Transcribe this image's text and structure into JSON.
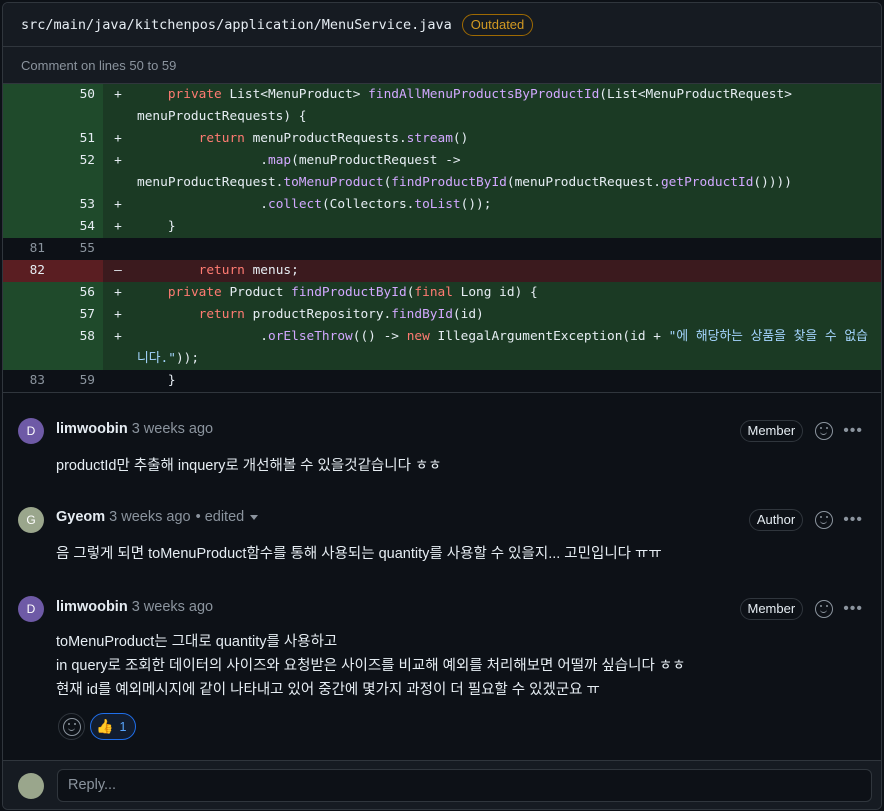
{
  "file": {
    "path": "src/main/java/kitchenpos/application/MenuService.java",
    "status_badge": "Outdated"
  },
  "subheader": "Comment on lines 50 to 59",
  "diff_lines": [
    {
      "type": "add",
      "old": "",
      "new": "50",
      "sign": "+",
      "code": "    private List<MenuProduct> findAllMenuProductsByProductId(List<MenuProductRequest> menuProductRequests) {"
    },
    {
      "type": "add",
      "old": "",
      "new": "51",
      "sign": "+",
      "code": "        return menuProductRequests.stream()"
    },
    {
      "type": "add",
      "old": "",
      "new": "52",
      "sign": "+",
      "code": "                .map(menuProductRequest -> menuProductRequest.toMenuProduct(findProductById(menuProductRequest.getProductId())))"
    },
    {
      "type": "add",
      "old": "",
      "new": "53",
      "sign": "+",
      "code": "                .collect(Collectors.toList());"
    },
    {
      "type": "add",
      "old": "",
      "new": "54",
      "sign": "+",
      "code": "    }"
    },
    {
      "type": "ctx",
      "old": "81",
      "new": "55",
      "sign": "",
      "code": ""
    },
    {
      "type": "del",
      "old": "82",
      "new": "",
      "sign": "–",
      "code": "        return menus;"
    },
    {
      "type": "add",
      "old": "",
      "new": "56",
      "sign": "+",
      "code": "    private Product findProductById(final Long id) {"
    },
    {
      "type": "add",
      "old": "",
      "new": "57",
      "sign": "+",
      "code": "        return productRepository.findById(id)"
    },
    {
      "type": "add",
      "old": "",
      "new": "58",
      "sign": "+",
      "code": "                .orElseThrow(() -> new IllegalArgumentException(id + \"에 해당하는 상품을 찾을 수 없습니다.\"));"
    },
    {
      "type": "ctx",
      "old": "83",
      "new": "59",
      "sign": "",
      "code": "    }"
    }
  ],
  "comments": [
    {
      "avatar": "D",
      "author": "limwoobin",
      "time": "3 weeks ago",
      "edited": "",
      "badge": "Member",
      "body": [
        "productId만 추출해 inquery로 개선해볼 수 있을것같습니다 ㅎㅎ"
      ]
    },
    {
      "avatar": "G",
      "author": "Gyeom",
      "time": "3 weeks ago",
      "edited": "• edited",
      "badge": "Author",
      "body": [
        "음 그렇게 되면 toMenuProduct함수를 통해 사용되는 quantity를 사용할 수 있을지... 고민입니다 ㅠㅠ"
      ]
    },
    {
      "avatar": "D",
      "author": "limwoobin",
      "time": "3 weeks ago",
      "edited": "",
      "badge": "Member",
      "body": [
        "toMenuProduct는 그대로 quantity를 사용하고",
        "in query로 조회한 데이터의 사이즈와 요청받은 사이즈를 비교해 예외를 처리해보면 어떨까 싶습니다 ㅎㅎ",
        "현재 id를 예외메시지에 같이 나타내고 있어 중간에 몇가지 과정이 더 필요할 수 있겠군요 ㅠ"
      ]
    }
  ],
  "reaction": {
    "emoji": "👍",
    "count": "1"
  },
  "reply": {
    "placeholder": "Reply..."
  },
  "colors": {
    "add_bg": "#1b3a24",
    "del_bg": "#3b1a1e",
    "accent": "#1f6feb",
    "outdated": "#d29922"
  }
}
